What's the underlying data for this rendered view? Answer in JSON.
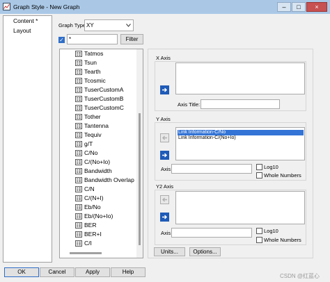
{
  "window": {
    "title": "Graph Style - New Graph",
    "controls": {
      "minimize": "–",
      "maximize": "□",
      "close": "×"
    }
  },
  "sidebar": {
    "items": [
      {
        "label": "Content *"
      },
      {
        "label": "Layout"
      }
    ]
  },
  "graph_type": {
    "label": "Graph Type",
    "value": "XY"
  },
  "filter": {
    "value": "*",
    "button": "Filter",
    "checked": true
  },
  "tree": {
    "items": [
      "Tatmos",
      "Tsun",
      "Tearth",
      "Tcosmic",
      "TuserCustomA",
      "TuserCustomB",
      "TuserCustomC",
      "Tother",
      "Tantenna",
      "Tequiv",
      "g/T",
      "C/No",
      "C/(No+Io)",
      "Bandwidth",
      "Bandwidth Overlap",
      "C/N",
      "C/(N+I)",
      "Eb/No",
      "Eb/(No+Io)",
      "BER",
      "BER+I",
      "C/I"
    ]
  },
  "x_axis": {
    "title": "X Axis",
    "axis_title_label": "Axis Title:",
    "axis_title_value": ""
  },
  "y_axis": {
    "title": "Y Axis",
    "items": [
      "Link Information-C/No",
      "Link Information-C/(No+Io)"
    ],
    "axis_label": "Axis",
    "log10": "Log10",
    "whole_numbers": "Whole Numbers"
  },
  "y2_axis": {
    "title": "Y2 Axis",
    "axis_label": "Axis",
    "log10": "Log10",
    "whole_numbers": "Whole Numbers"
  },
  "buttons": {
    "units": "Units...",
    "options": "Options..."
  },
  "footer": {
    "ok": "OK",
    "cancel": "Cancel",
    "apply": "Apply",
    "help": "Help"
  },
  "watermark": "CSDN @红蓝心",
  "icons": {
    "app": "graph-window-icon",
    "dropdown": "chevron-down-icon",
    "add": "arrow-right-icon",
    "remove": "arrow-left-icon"
  },
  "colors": {
    "titlebar": "#aac8e6",
    "selection": "#3374d6",
    "arrow_active": "#1f5bb8",
    "close": "#c75050"
  }
}
